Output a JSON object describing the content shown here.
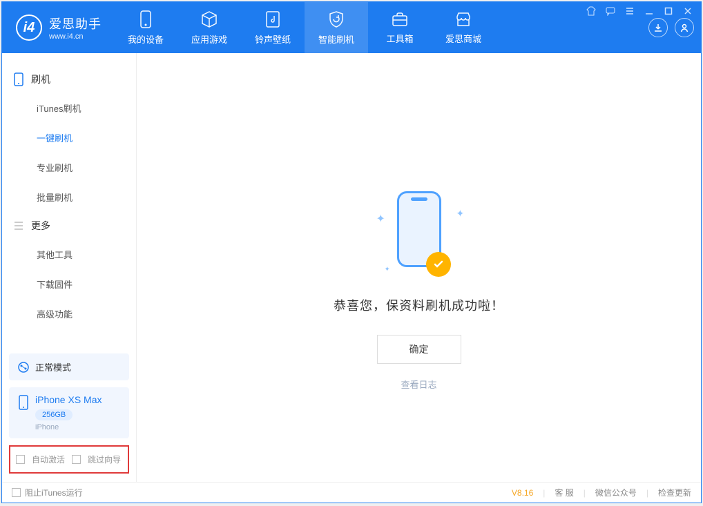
{
  "app": {
    "name_cn": "爱思助手",
    "url": "www.i4.cn"
  },
  "nav": {
    "items": [
      {
        "label": "我的设备"
      },
      {
        "label": "应用游戏"
      },
      {
        "label": "铃声壁纸"
      },
      {
        "label": "智能刷机"
      },
      {
        "label": "工具箱"
      },
      {
        "label": "爱思商城"
      }
    ]
  },
  "sidebar": {
    "group1": {
      "label": "刷机"
    },
    "items1": [
      {
        "label": "iTunes刷机"
      },
      {
        "label": "一键刷机"
      },
      {
        "label": "专业刷机"
      },
      {
        "label": "批量刷机"
      }
    ],
    "group2": {
      "label": "更多"
    },
    "items2": [
      {
        "label": "其他工具"
      },
      {
        "label": "下载固件"
      },
      {
        "label": "高级功能"
      }
    ],
    "mode_label": "正常模式",
    "device": {
      "name": "iPhone XS Max",
      "capacity": "256GB",
      "type": "iPhone"
    },
    "checks": {
      "auto_activate": "自动激活",
      "skip_guide": "跳过向导"
    }
  },
  "main": {
    "success_msg": "恭喜您，保资料刷机成功啦！",
    "ok_label": "确定",
    "view_log": "查看日志"
  },
  "status": {
    "block_itunes": "阻止iTunes运行",
    "version": "V8.16",
    "service": "客 服",
    "wechat": "微信公众号",
    "check_update": "检查更新"
  }
}
